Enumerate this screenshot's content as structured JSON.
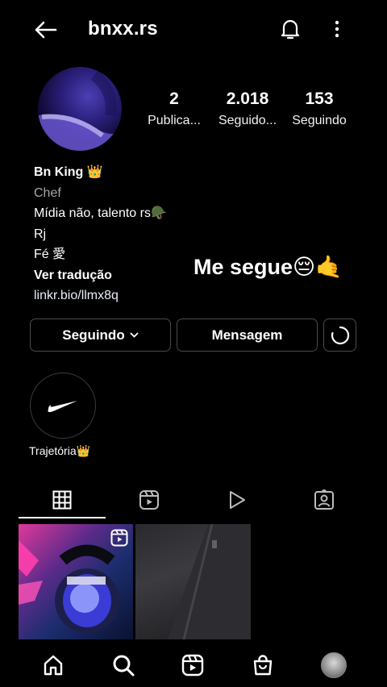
{
  "header": {
    "username": "bnxx.rs",
    "icons": [
      "back-arrow-icon",
      "bell-icon",
      "more-vertical-icon"
    ]
  },
  "stats": {
    "posts": {
      "value": "2",
      "label": "Publica..."
    },
    "followers": {
      "value": "2.018",
      "label": "Seguido..."
    },
    "following": {
      "value": "153",
      "label": "Seguindo"
    }
  },
  "bio": {
    "name": "Bn King 👑",
    "category": "Chef",
    "lines": [
      "Mídia não, talento rs🪖",
      "Rj",
      "Fé 愛"
    ],
    "translate": "Ver tradução",
    "link": "linkr.bio/llmx8q"
  },
  "overlay": "Me segue😔🤙",
  "actions": {
    "following": "Seguindo",
    "message": "Mensagem"
  },
  "highlights": [
    {
      "label": "Trajetória👑",
      "icon": "nike-swoosh-icon"
    }
  ],
  "tabs": [
    "grid-icon",
    "reels-icon",
    "play-icon",
    "tagged-icon"
  ],
  "nav": [
    "home-icon",
    "search-icon",
    "reels-icon",
    "shop-icon",
    "profile-avatar"
  ]
}
